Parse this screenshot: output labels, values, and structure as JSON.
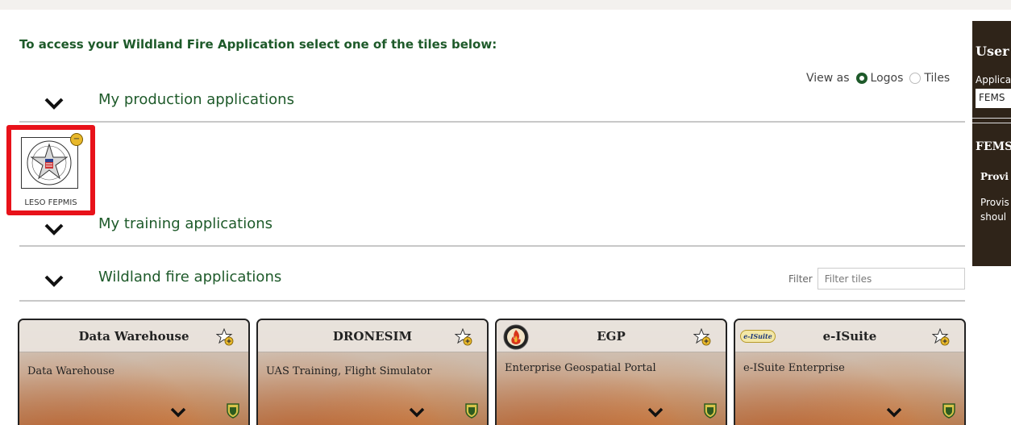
{
  "intro": "To access your Wildland Fire Application select one of the tiles below:",
  "view_as": {
    "label": "View as",
    "options": [
      "Logos",
      "Tiles"
    ],
    "selected": "Logos"
  },
  "sections": {
    "production": "My production applications",
    "training": "My training applications",
    "wildland": "Wildland fire applications"
  },
  "filter": {
    "label": "Filter",
    "placeholder": "Filter tiles"
  },
  "production_apps": [
    {
      "caption": "LESO FEPMIS",
      "icon": "leso-star-seal"
    }
  ],
  "tiles": [
    {
      "name": "Data Warehouse",
      "description": "Data Warehouse"
    },
    {
      "name": "DRONESIM",
      "description": "UAS Training, Flight Simulator"
    },
    {
      "name": "EGP",
      "description": "Enterprise Geospatial Portal"
    },
    {
      "name": "e-ISuite",
      "description": "e-ISuite Enterprise",
      "logo_text": "e-ISuite"
    }
  ],
  "side_panel": {
    "user": "User",
    "application_label": "Applica",
    "application_value": "FEMS",
    "section_title": "FEMS",
    "item_title": "Provi",
    "item_text_1": "Provis",
    "item_text_2": "shoul"
  },
  "colors": {
    "accent_green": "#1e5a2a",
    "highlight_red": "#e8121a",
    "panel_brown": "#2f2419"
  }
}
